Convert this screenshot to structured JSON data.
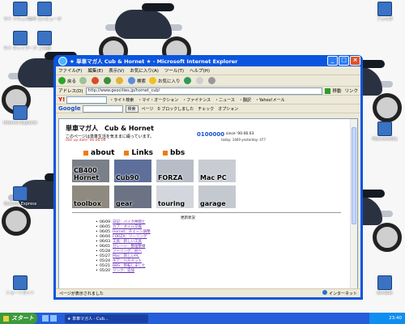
{
  "window": {
    "title": "★ 単車マガ人 Cub & Hornet ★ - Microsoft Internet Explorer",
    "min": "_",
    "max": "□",
    "close": "×"
  },
  "menu": [
    "ファイル(F)",
    "編集(E)",
    "表示(V)",
    "お気に入り(A)",
    "ツール(T)",
    "ヘルプ(H)"
  ],
  "toolbar": {
    "back": "戻る",
    "search": "検索",
    "favorites": "お気に入り"
  },
  "address": {
    "label": "アドレス(D)",
    "url": "http://www.geocities.jp/hornet_cub/",
    "go": "移動",
    "links": "リンク"
  },
  "yahoo_bar": {
    "logo": "Y!",
    "items": [
      "・ライト検索",
      "・マイ・オークション",
      "・ファイナンス",
      "・ニュース",
      "・翻訳",
      "・Yahoo!メール"
    ]
  },
  "google_bar": {
    "logo": "Google",
    "search_btn": "検索",
    "items": [
      "ページ",
      "0 ブロックしました",
      "チェック",
      "オプション"
    ]
  },
  "page": {
    "title": "単車マガ人　Cub & Hornet",
    "subtitle": "このページは単車生活を気ままに綴っています。",
    "updated": "last up date '06.06.09",
    "counter": "0100000",
    "since": "since '00.06.03",
    "today": "today: 1469   yesterday: 477",
    "nav": [
      "about",
      "Links",
      "bbs"
    ],
    "tiles": [
      {
        "label": "CB400\nHornet"
      },
      {
        "label": "Cub90"
      },
      {
        "label": "FORZA"
      },
      {
        "label": "Mac PC"
      },
      {
        "label": "toolbox"
      },
      {
        "label": "gear"
      },
      {
        "label": "touring"
      },
      {
        "label": "garage"
      }
    ],
    "updates_title": "更新状況",
    "updates": [
      {
        "date": "06/09",
        "text": "日記：バイク仲間と"
      },
      {
        "date": "06/05",
        "text": "カブ：オイル交換"
      },
      {
        "date": "06/05",
        "text": "Hornet：チェーン調整"
      },
      {
        "date": "06/04",
        "text": "FORZA：ツーリング"
      },
      {
        "date": "06/03",
        "text": "工具：新しい工具"
      },
      {
        "date": "06/01",
        "text": "ガレージ：整理整頓"
      },
      {
        "date": "05/28",
        "text": "ツーリング：峠へ"
      },
      {
        "date": "05/27",
        "text": "Mac：新しいPC"
      },
      {
        "date": "05/24",
        "text": "ギア：ヘルメット"
      },
      {
        "date": "05/21",
        "text": "BBS：移転しました"
      },
      {
        "date": "05/20",
        "text": "リンク：追加"
      }
    ]
  },
  "status": {
    "text": "ページが表示されました",
    "zone": "インターネット"
  },
  "taskbar": {
    "start": "スタート",
    "task": "★ 単車マガ人 - Cub...",
    "clock": "23:40"
  },
  "desktop_icons": [
    "マイ ドキュメント",
    "マイ コンピュータ",
    "マイ ネットワーク",
    "ごみ箱",
    "Internet Explorer",
    "Outlook Express",
    "ショートカット",
    "フォルダ",
    "Macromedia",
    "Acrobat"
  ]
}
